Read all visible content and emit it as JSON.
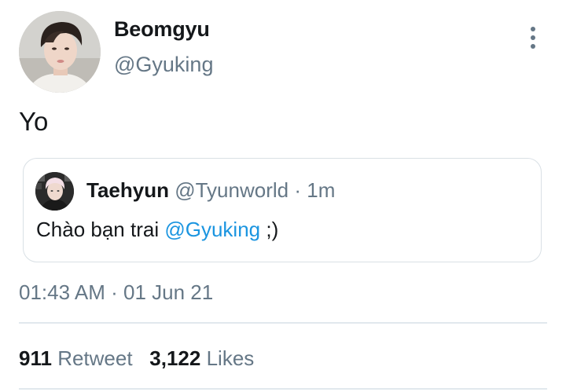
{
  "tweet": {
    "author": {
      "display_name": "Beomgyu",
      "handle": "@Gyuking"
    },
    "text": "Yo",
    "more_icon": "more-vertical-icon",
    "quoted": {
      "display_name": "Taehyun",
      "handle": "@Tyunworld",
      "separator": "·",
      "time": "1m",
      "text_before": "Chào bạn trai",
      "mention": "@Gyuking",
      "text_after": ";)"
    },
    "timestamp": {
      "time": "01:43 AM",
      "separator": "·",
      "date": "01 Jun 21"
    },
    "stats": {
      "retweets_count": "911",
      "retweets_label": "Retweet",
      "likes_count": "3,122",
      "likes_label": "Likes"
    }
  },
  "colors": {
    "text_primary": "#14171a",
    "text_secondary": "#657786",
    "link": "#1b95e0",
    "border": "#d9e0e5"
  }
}
